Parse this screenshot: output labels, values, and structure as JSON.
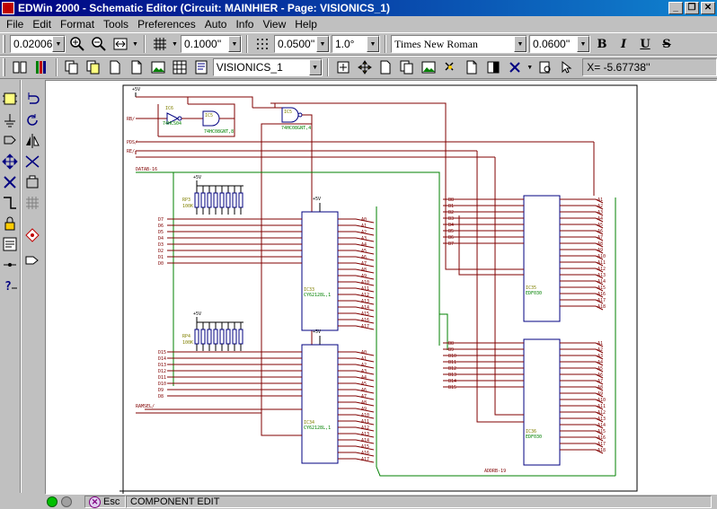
{
  "window": {
    "title": "EDWin 2000 - Schematic Editor (Circuit: MAINHIER - Page: VISIONICS_1)",
    "controls": [
      "_",
      "❐",
      "✕"
    ]
  },
  "menu": [
    "File",
    "Edit",
    "Format",
    "Tools",
    "Preferences",
    "Auto",
    "Info",
    "View",
    "Help"
  ],
  "toolbar1": {
    "zoom_value": "0.02006''",
    "grid_value": "0.1000''",
    "snap_value": "0.0500''",
    "angle_value": "1.0°",
    "font_name": "Times New Roman",
    "font_size": "0.0600''",
    "bold": "B",
    "italic": "I",
    "underline": "U",
    "strike": "S"
  },
  "toolbar2": {
    "page_select": "VISIONICS_1",
    "coordinate_readout": "X= -5.67738''"
  },
  "status": {
    "esc_label": "Esc",
    "mode": "COMPONENT EDIT"
  },
  "colors": {
    "wire": "#800000",
    "bus": "#008000",
    "component": "#000080",
    "pin_label": "#800000",
    "ref_label": "#808000"
  },
  "schematic": {
    "power_labels": [
      "+5V",
      "+5V",
      "+5V",
      "+5V",
      "+5V"
    ],
    "net_labels_left": [
      "RB/",
      "PDS/",
      "RE/",
      "DATAB-16",
      "RAMSEL/"
    ],
    "bus_label_bottom": "ADDRB-19",
    "gates": [
      {
        "ref": "IC6",
        "part": "74HCS04"
      },
      {
        "ref": "IC5",
        "part": "74HC08GNT,8"
      },
      {
        "ref": "IC5",
        "part": "74HC08GNT,4"
      }
    ],
    "resistor_packs": [
      {
        "ref": "RP3",
        "value": "100K"
      },
      {
        "ref": "RP4",
        "value": "100K"
      }
    ],
    "rams": [
      {
        "ref": "IC33",
        "part": "CY62128L,1"
      },
      {
        "ref": "IC34",
        "part": "CY62128L,1"
      }
    ],
    "buffers": [
      {
        "ref": "IC35",
        "part": "EDF030"
      },
      {
        "ref": "IC36",
        "part": "EDF030"
      }
    ],
    "data_upper": [
      "D7",
      "D6",
      "D5",
      "D4",
      "D3",
      "D2",
      "D1",
      "D0"
    ],
    "data_lower": [
      "D15",
      "D14",
      "D13",
      "D12",
      "D11",
      "D10",
      "D9",
      "D8"
    ],
    "addr_ram": [
      "A0",
      "A1",
      "A2",
      "A3",
      "A4",
      "A5",
      "A6",
      "A7",
      "A8",
      "A9",
      "A10",
      "A11",
      "A12",
      "A13",
      "A14",
      "A15",
      "A16",
      "A17"
    ],
    "buf_in_upper": [
      "B8",
      "B1",
      "B2",
      "B3",
      "B4",
      "B5",
      "B6",
      "B7"
    ],
    "buf_in_lower": [
      "B8",
      "B9",
      "B10",
      "B11",
      "B12",
      "B13",
      "B14",
      "B15"
    ],
    "addr_buf_upper": [
      "A1",
      "A2",
      "A3",
      "A4",
      "A5",
      "A6",
      "A7",
      "A8",
      "A9",
      "A10",
      "A11",
      "A12",
      "A13",
      "A14",
      "A15",
      "A16",
      "A17",
      "A18"
    ],
    "addr_buf_lower": [
      "A1",
      "A2",
      "A3",
      "A4",
      "A5",
      "A6",
      "A7",
      "A8",
      "A9",
      "A10",
      "A11",
      "A12",
      "A13",
      "A14",
      "A15",
      "A16",
      "A17",
      "A18"
    ]
  }
}
